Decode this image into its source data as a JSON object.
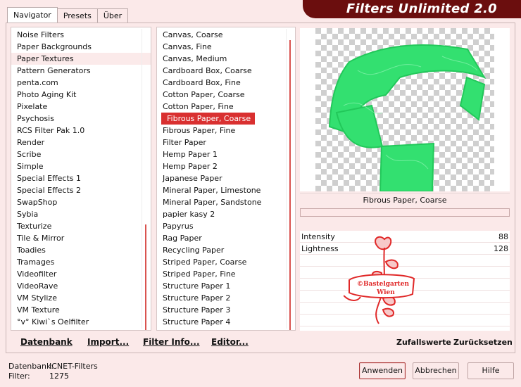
{
  "tabs": [
    "Navigator",
    "Presets",
    "Über"
  ],
  "banner_title": "Filters Unlimited 2.0",
  "categories": [
    "Noise Filters",
    "Paper Backgrounds",
    "Paper Textures",
    "Pattern Generators",
    "penta.com",
    "Photo Aging Kit",
    "Pixelate",
    "Psychosis",
    "RCS Filter Pak 1.0",
    "Render",
    "Scribe",
    "Simple",
    "Special Effects 1",
    "Special Effects 2",
    "SwapShop",
    "Sybia",
    "Texturize",
    "Tile & Mirror",
    "Toadies",
    "Tramages",
    "Videofilter",
    "VideoRave",
    "VM Stylize",
    "VM Texture",
    "°v° Kiwi`s Oelfilter"
  ],
  "selected_category": "Paper Textures",
  "filters": [
    "Canvas, Coarse",
    "Canvas, Fine",
    "Canvas, Medium",
    "Cardboard Box, Coarse",
    "Cardboard Box, Fine",
    "Cotton Paper, Coarse",
    "Cotton Paper, Fine",
    "Fibrous Paper, Coarse",
    "Fibrous Paper, Fine",
    "Filter Paper",
    "Hemp Paper 1",
    "Hemp Paper 2",
    "Japanese Paper",
    "Mineral Paper, Limestone",
    "Mineral Paper, Sandstone",
    "papier kasy 2",
    "Papyrus",
    "Rag Paper",
    "Recycling Paper",
    "Striped Paper, Coarse",
    "Striped Paper, Fine",
    "Structure Paper 1",
    "Structure Paper 2",
    "Structure Paper 3",
    "Structure Paper 4"
  ],
  "selected_filter": "Fibrous Paper, Coarse",
  "bottom_links": {
    "database": "Datenbank",
    "import": "Import...",
    "filter_info": "Filter Info...",
    "editor": "Editor..."
  },
  "preview_filter_name": "Fibrous Paper, Coarse",
  "params": [
    {
      "name": "Intensity",
      "value": "88"
    },
    {
      "name": "Lightness",
      "value": "128"
    }
  ],
  "watermark_text": [
    "©Bastelgarten",
    "Wien"
  ],
  "right_links": {
    "random": "Zufallswerte",
    "reset": "Zurücksetzen"
  },
  "status": {
    "db_label": "Datenbank:",
    "db_value": "ICNET-Filters",
    "filter_label": "Filter:",
    "filter_value": "1275"
  },
  "buttons": {
    "apply": "Anwenden",
    "cancel": "Abbrechen",
    "help": "Hilfe"
  },
  "colors": {
    "accent": "#d93030",
    "banner": "#6b0e0e",
    "preview_green": "#33e070",
    "background": "#fbe9e9"
  }
}
